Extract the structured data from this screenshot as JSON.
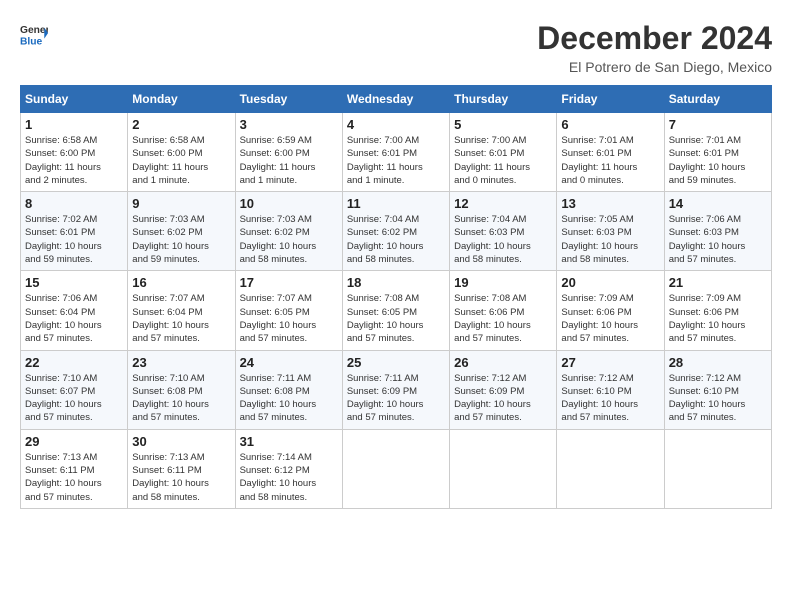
{
  "header": {
    "logo_line1": "General",
    "logo_line2": "Blue",
    "month": "December 2024",
    "location": "El Potrero de San Diego, Mexico"
  },
  "weekdays": [
    "Sunday",
    "Monday",
    "Tuesday",
    "Wednesday",
    "Thursday",
    "Friday",
    "Saturday"
  ],
  "weeks": [
    [
      {
        "day": "1",
        "info": "Sunrise: 6:58 AM\nSunset: 6:00 PM\nDaylight: 11 hours\nand 2 minutes."
      },
      {
        "day": "2",
        "info": "Sunrise: 6:58 AM\nSunset: 6:00 PM\nDaylight: 11 hours\nand 1 minute."
      },
      {
        "day": "3",
        "info": "Sunrise: 6:59 AM\nSunset: 6:00 PM\nDaylight: 11 hours\nand 1 minute."
      },
      {
        "day": "4",
        "info": "Sunrise: 7:00 AM\nSunset: 6:01 PM\nDaylight: 11 hours\nand 1 minute."
      },
      {
        "day": "5",
        "info": "Sunrise: 7:00 AM\nSunset: 6:01 PM\nDaylight: 11 hours\nand 0 minutes."
      },
      {
        "day": "6",
        "info": "Sunrise: 7:01 AM\nSunset: 6:01 PM\nDaylight: 11 hours\nand 0 minutes."
      },
      {
        "day": "7",
        "info": "Sunrise: 7:01 AM\nSunset: 6:01 PM\nDaylight: 10 hours\nand 59 minutes."
      }
    ],
    [
      {
        "day": "8",
        "info": "Sunrise: 7:02 AM\nSunset: 6:01 PM\nDaylight: 10 hours\nand 59 minutes."
      },
      {
        "day": "9",
        "info": "Sunrise: 7:03 AM\nSunset: 6:02 PM\nDaylight: 10 hours\nand 59 minutes."
      },
      {
        "day": "10",
        "info": "Sunrise: 7:03 AM\nSunset: 6:02 PM\nDaylight: 10 hours\nand 58 minutes."
      },
      {
        "day": "11",
        "info": "Sunrise: 7:04 AM\nSunset: 6:02 PM\nDaylight: 10 hours\nand 58 minutes."
      },
      {
        "day": "12",
        "info": "Sunrise: 7:04 AM\nSunset: 6:03 PM\nDaylight: 10 hours\nand 58 minutes."
      },
      {
        "day": "13",
        "info": "Sunrise: 7:05 AM\nSunset: 6:03 PM\nDaylight: 10 hours\nand 58 minutes."
      },
      {
        "day": "14",
        "info": "Sunrise: 7:06 AM\nSunset: 6:03 PM\nDaylight: 10 hours\nand 57 minutes."
      }
    ],
    [
      {
        "day": "15",
        "info": "Sunrise: 7:06 AM\nSunset: 6:04 PM\nDaylight: 10 hours\nand 57 minutes."
      },
      {
        "day": "16",
        "info": "Sunrise: 7:07 AM\nSunset: 6:04 PM\nDaylight: 10 hours\nand 57 minutes."
      },
      {
        "day": "17",
        "info": "Sunrise: 7:07 AM\nSunset: 6:05 PM\nDaylight: 10 hours\nand 57 minutes."
      },
      {
        "day": "18",
        "info": "Sunrise: 7:08 AM\nSunset: 6:05 PM\nDaylight: 10 hours\nand 57 minutes."
      },
      {
        "day": "19",
        "info": "Sunrise: 7:08 AM\nSunset: 6:06 PM\nDaylight: 10 hours\nand 57 minutes."
      },
      {
        "day": "20",
        "info": "Sunrise: 7:09 AM\nSunset: 6:06 PM\nDaylight: 10 hours\nand 57 minutes."
      },
      {
        "day": "21",
        "info": "Sunrise: 7:09 AM\nSunset: 6:06 PM\nDaylight: 10 hours\nand 57 minutes."
      }
    ],
    [
      {
        "day": "22",
        "info": "Sunrise: 7:10 AM\nSunset: 6:07 PM\nDaylight: 10 hours\nand 57 minutes."
      },
      {
        "day": "23",
        "info": "Sunrise: 7:10 AM\nSunset: 6:08 PM\nDaylight: 10 hours\nand 57 minutes."
      },
      {
        "day": "24",
        "info": "Sunrise: 7:11 AM\nSunset: 6:08 PM\nDaylight: 10 hours\nand 57 minutes."
      },
      {
        "day": "25",
        "info": "Sunrise: 7:11 AM\nSunset: 6:09 PM\nDaylight: 10 hours\nand 57 minutes."
      },
      {
        "day": "26",
        "info": "Sunrise: 7:12 AM\nSunset: 6:09 PM\nDaylight: 10 hours\nand 57 minutes."
      },
      {
        "day": "27",
        "info": "Sunrise: 7:12 AM\nSunset: 6:10 PM\nDaylight: 10 hours\nand 57 minutes."
      },
      {
        "day": "28",
        "info": "Sunrise: 7:12 AM\nSunset: 6:10 PM\nDaylight: 10 hours\nand 57 minutes."
      }
    ],
    [
      {
        "day": "29",
        "info": "Sunrise: 7:13 AM\nSunset: 6:11 PM\nDaylight: 10 hours\nand 57 minutes."
      },
      {
        "day": "30",
        "info": "Sunrise: 7:13 AM\nSunset: 6:11 PM\nDaylight: 10 hours\nand 58 minutes."
      },
      {
        "day": "31",
        "info": "Sunrise: 7:14 AM\nSunset: 6:12 PM\nDaylight: 10 hours\nand 58 minutes."
      },
      null,
      null,
      null,
      null
    ]
  ]
}
